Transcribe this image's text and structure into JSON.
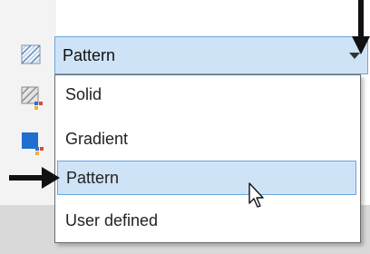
{
  "combo": {
    "selected": "Pattern"
  },
  "dropdown": {
    "items": [
      {
        "label": "Solid"
      },
      {
        "label": "Gradient"
      },
      {
        "label": "Pattern"
      },
      {
        "label": "User defined"
      }
    ]
  },
  "colors": {
    "selection_fill": "#cfe3f7",
    "selection_border": "#6aa6de",
    "swatch_blue": "#1f6fd1"
  },
  "icons": {
    "hatch_pattern": "hatch-pattern-icon",
    "hatch_gradient": "hatch-gradient-icon",
    "color_swatch": "color-swatch-icon",
    "expand": "chevron-down-icon",
    "pointer": "mouse-pointer-icon"
  }
}
